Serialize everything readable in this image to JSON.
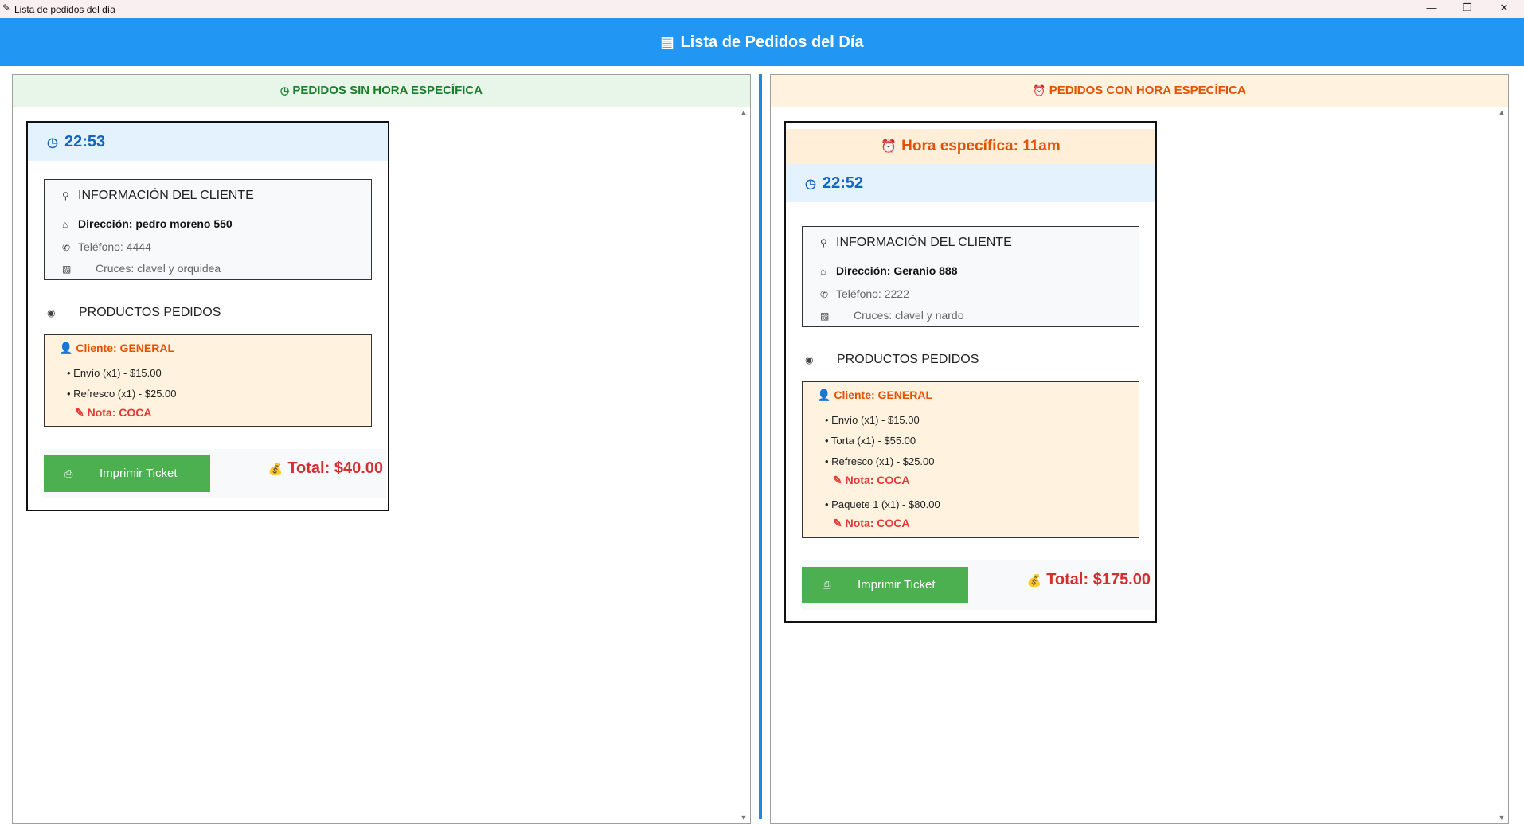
{
  "window": {
    "title": "Lista de pedidos del día",
    "minimize": "—",
    "restore": "❐",
    "close": "✕"
  },
  "header": {
    "title": "Lista de Pedidos del Día",
    "icon": "receipt-icon"
  },
  "panels": {
    "left": {
      "title": "PEDIDOS SIN HORA ESPECÍFICA",
      "icon": "clock-icon",
      "header_color": "#e8f5e9",
      "text_color": "#1b7e2c"
    },
    "right": {
      "title": "PEDIDOS CON HORA ESPECÍFICA",
      "icon": "alarm-icon",
      "header_color": "#fff3e0",
      "text_color": "#e65100"
    }
  },
  "orders": {
    "left": {
      "time": "22:53",
      "info_title": "INFORMACIÓN DEL CLIENTE",
      "address": "Dirección: pedro moreno 550",
      "phone": "Teléfono: 4444",
      "cruces": "Cruces: clavel y orquidea",
      "products_title": "PRODUCTOS PEDIDOS",
      "client": "Cliente: GENERAL",
      "items": [
        "• Envío (x1) - $15.00",
        "• Refresco (x1) - $25.00"
      ],
      "notes": [
        "Nota: COCA"
      ],
      "print_label": "Imprimir Ticket",
      "total": "Total: $40.00"
    },
    "right": {
      "hora": "Hora específica: 11am",
      "time": "22:52",
      "info_title": "INFORMACIÓN DEL CLIENTE",
      "address": "Dirección: Geranio 888",
      "phone": "Teléfono: 2222",
      "cruces": "Cruces: clavel y nardo",
      "products_title": "PRODUCTOS PEDIDOS",
      "client": "Cliente: GENERAL",
      "items": [
        "• Envío (x1) - $15.00",
        "• Torta (x1) - $55.00",
        "• Refresco (x1) - $25.00",
        "• Paquete 1 (x1) - $80.00"
      ],
      "notes": [
        "Nota: COCA",
        "Nota: COCA"
      ],
      "print_label": "Imprimir Ticket",
      "total": "Total: $175.00"
    }
  },
  "colors": {
    "header_blue": "#2196f3",
    "time_blue": "#1565c0",
    "print_green": "#4caf50",
    "total_red": "#d32f2f",
    "divider_blue": "#1e88e5"
  }
}
